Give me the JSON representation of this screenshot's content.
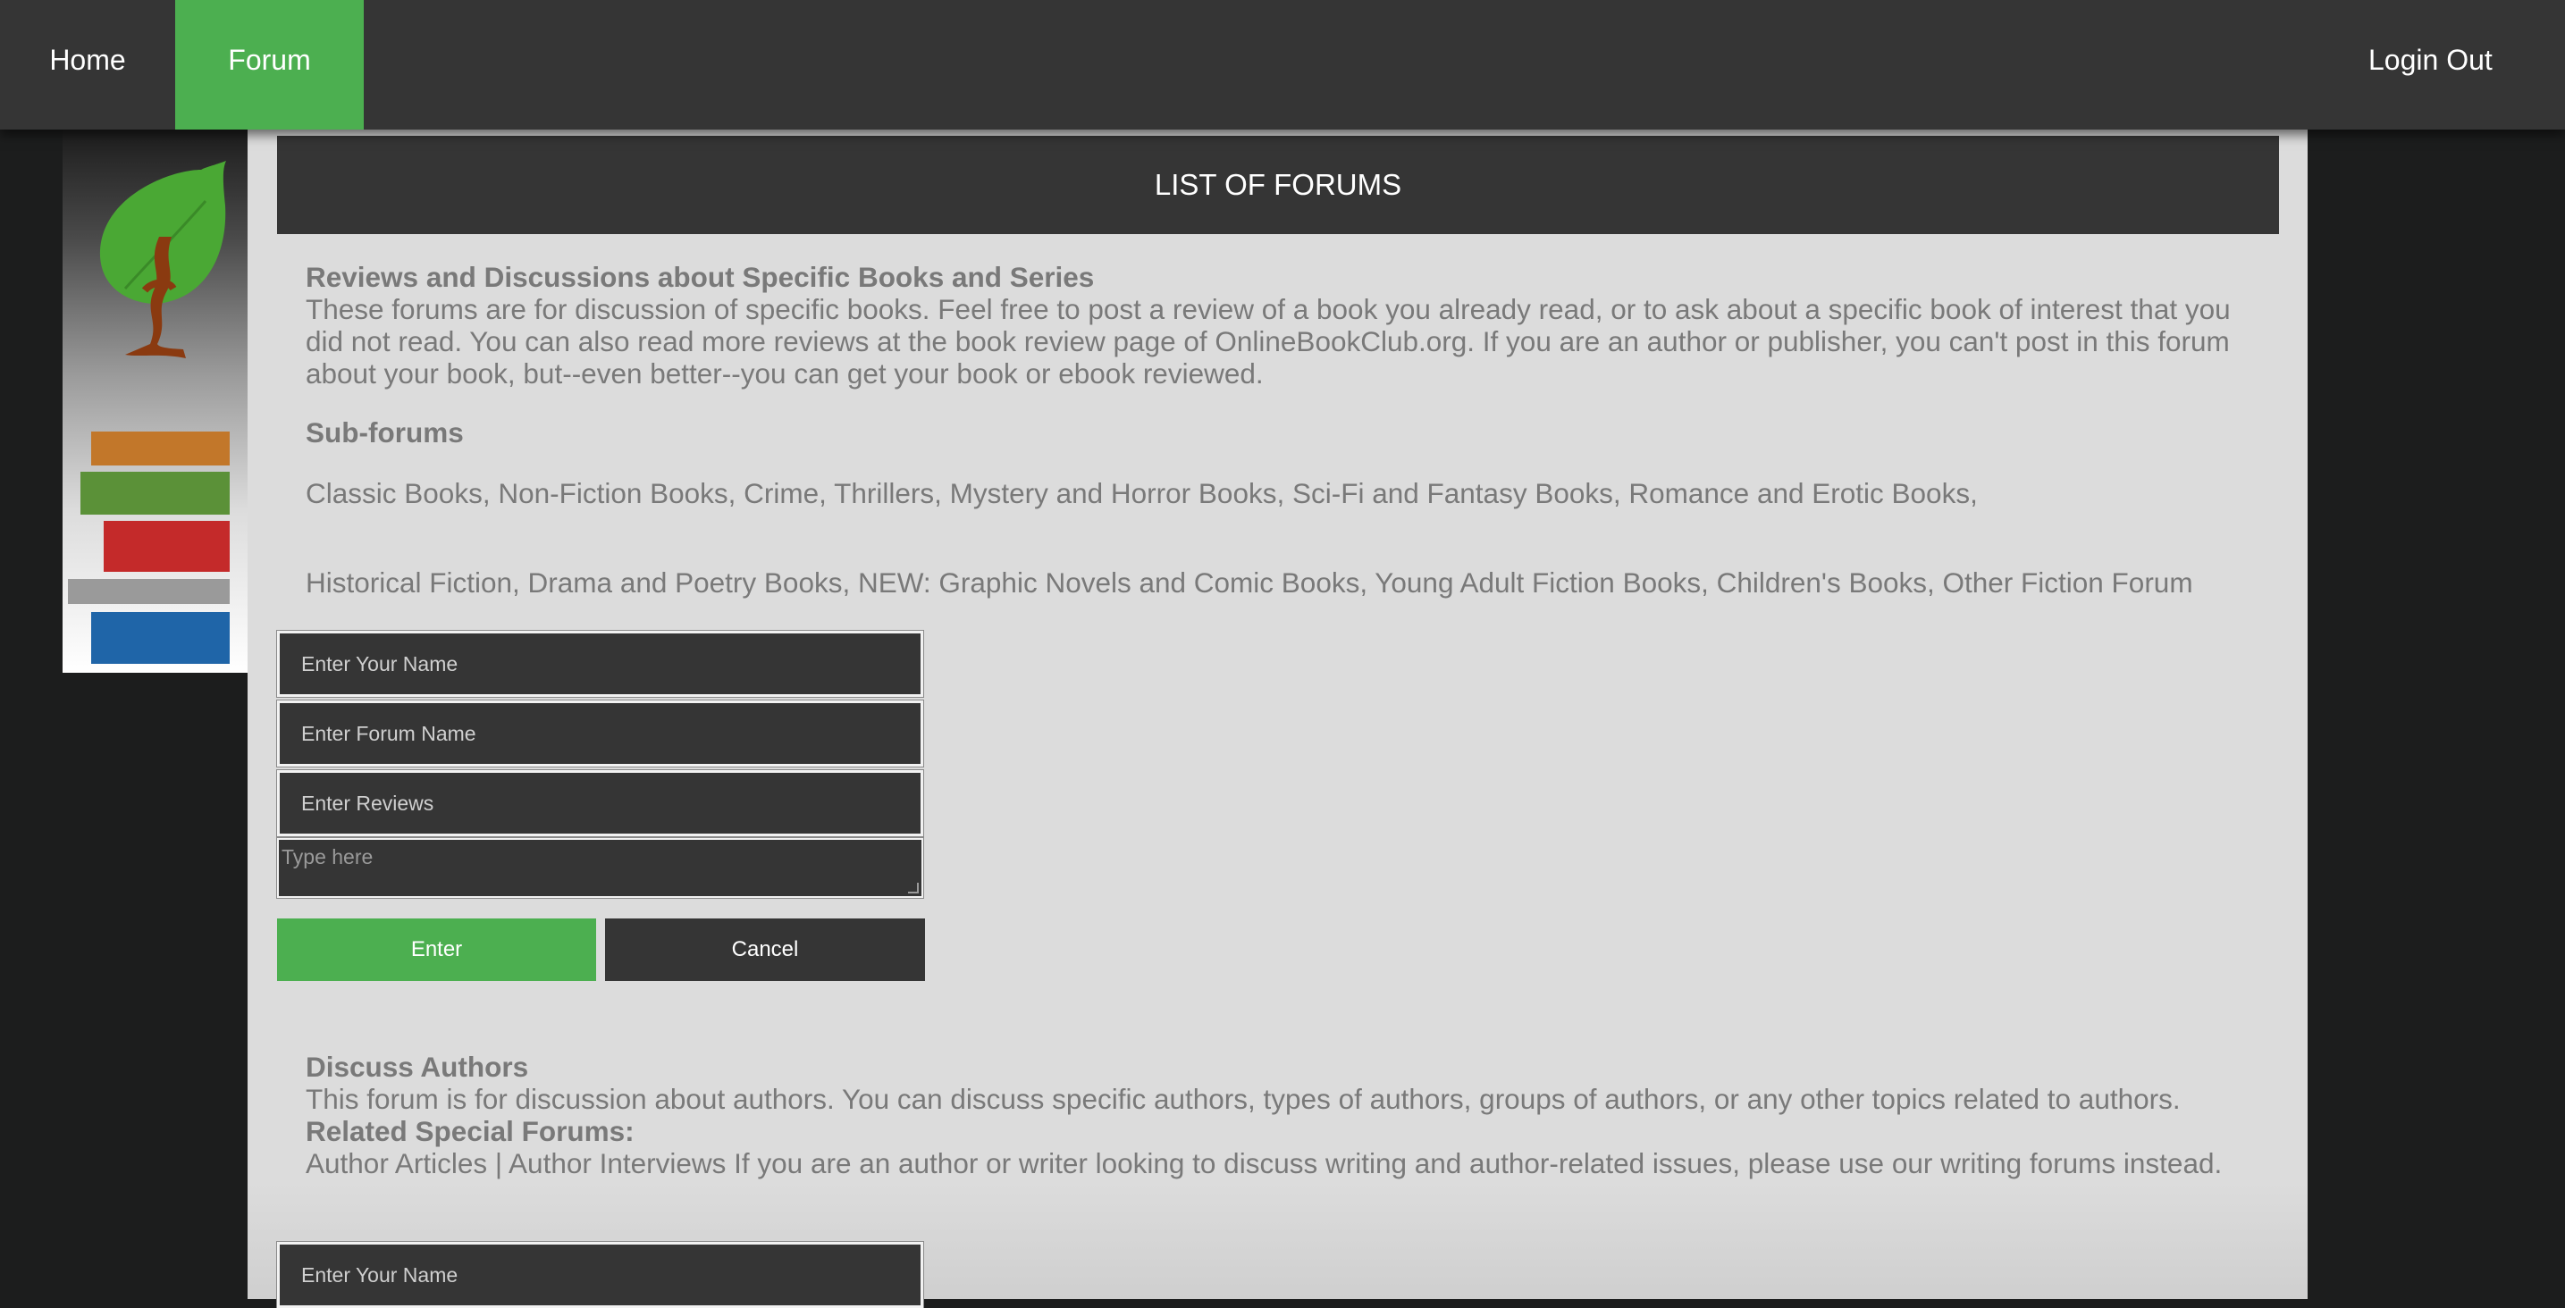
{
  "nav": {
    "home": "Home",
    "forum": "Forum",
    "logout": "Login Out",
    "active_color": "#4caf50"
  },
  "page": {
    "title": "LIST OF FORUMS"
  },
  "section1": {
    "heading": "Reviews and Discussions about Specific Books and Series",
    "description": "These forums are for discussion of specific books. Feel free to post a review of a book you already read, or to ask about a specific book of interest that you did not read. You can also read more reviews at the book review page of OnlineBookClub.org. If you are an author or publisher, you can't post in this forum about your book, but--even better--you can get your book or ebook reviewed.",
    "subforums_heading": "Sub-forums",
    "subforums_line1": "Classic Books, Non-Fiction Books, Crime, Thrillers, Mystery and Horror Books, Sci-Fi and Fantasy Books, Romance and Erotic Books,",
    "subforums_line2": "Historical Fiction, Drama and Poetry Books, NEW: Graphic Novels and Comic Books, Young Adult Fiction Books, Children's Books, Other Fiction Forum"
  },
  "form1": {
    "name_placeholder": "Enter Your Name",
    "forum_placeholder": "Enter Forum Name",
    "reviews_placeholder": "Enter Reviews",
    "textarea_placeholder": "Type here",
    "enter_label": "Enter",
    "cancel_label": "Cancel"
  },
  "section2": {
    "heading": "Discuss Authors",
    "description": "This forum is for discussion about authors. You can discuss specific authors, types of authors, groups of authors, or any other topics related to authors.",
    "related_heading": "Related Special Forums:",
    "related_text": "Author Articles | Author Interviews If you are an author or writer looking to discuss writing and author-related issues, please use our writing forums instead."
  },
  "form2": {
    "name_placeholder": "Enter Your Name"
  },
  "logo": {
    "icon": "book-stack-leaf-logo",
    "book_colors": [
      "#c2772a",
      "#5b9138",
      "#c42a2a",
      "#9a9a9a",
      "#1f65a8"
    ]
  }
}
